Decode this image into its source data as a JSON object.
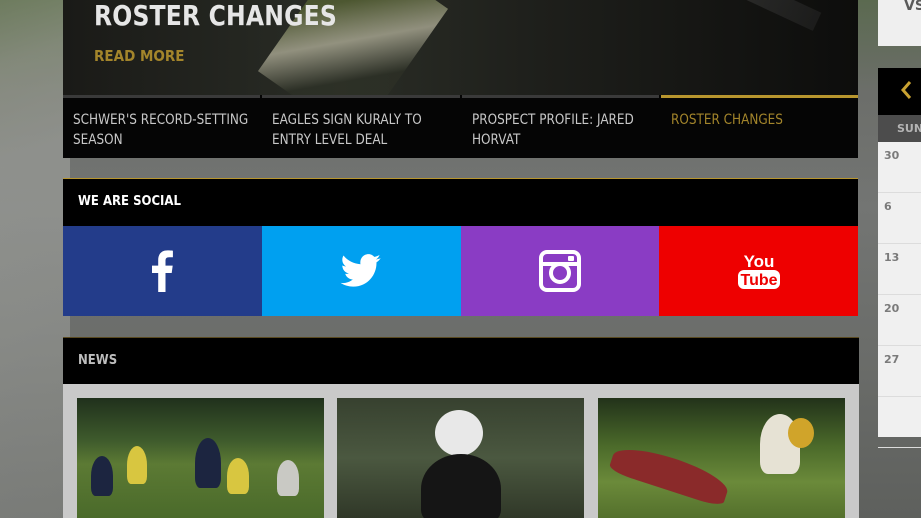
{
  "hero": {
    "title": "ROSTER CHANGES",
    "read_more": "READ MORE"
  },
  "news_tabs": [
    {
      "label": "SCHWER'S RECORD-SETTING SEASON",
      "active": false
    },
    {
      "label": "EAGLES SIGN KURALY TO ENTRY LEVEL DEAL",
      "active": false
    },
    {
      "label": "PROSPECT PROFILE: JARED HORVAT",
      "active": false
    },
    {
      "label": "ROSTER CHANGES",
      "active": true
    }
  ],
  "social": {
    "title": "WE ARE SOCIAL",
    "networks": [
      {
        "name": "facebook",
        "icon": "facebook-icon",
        "color": "#233c8a"
      },
      {
        "name": "twitter",
        "icon": "twitter-icon",
        "color": "#00a0f0"
      },
      {
        "name": "instagram",
        "icon": "instagram-icon",
        "color": "#8a3cc4"
      },
      {
        "name": "youtube",
        "icon": "youtube-icon",
        "color": "#ee0000",
        "logo_text": [
          "You",
          "Tube"
        ]
      }
    ]
  },
  "news": {
    "title": "NEWS",
    "cards": [
      {
        "image": "youth-football-lineup"
      },
      {
        "image": "youth-football-player-portrait"
      },
      {
        "image": "youth-football-tackle"
      }
    ]
  },
  "sidebar": {
    "matchup_label": "VS",
    "calendar": {
      "day_header": "SUN",
      "dates": [
        "30",
        "6",
        "13",
        "20",
        "27"
      ]
    }
  },
  "colors": {
    "accent_gold": "#b8962e",
    "read_more_gold": "#a3852b"
  }
}
